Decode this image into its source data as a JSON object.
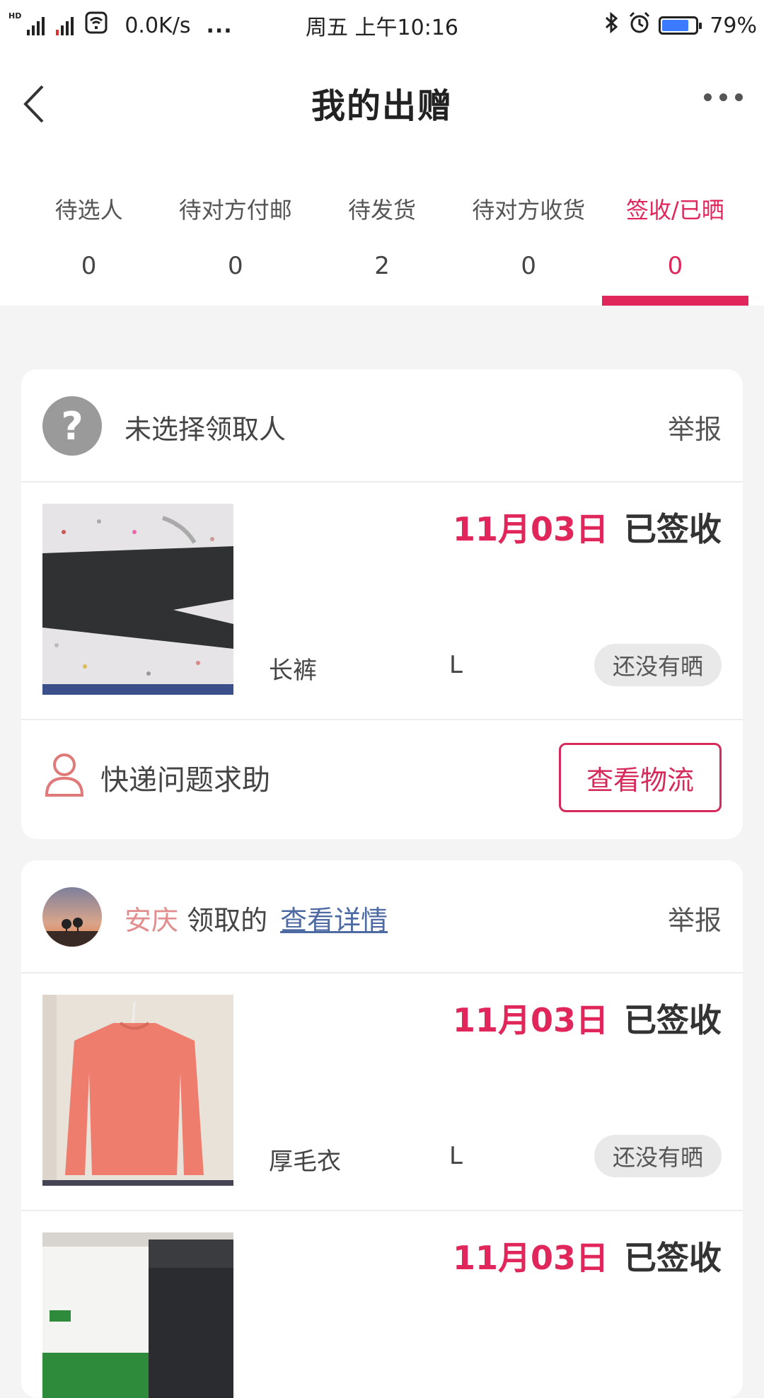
{
  "status_bar": {
    "hd": "HD",
    "speed": "0.0K/s",
    "dots": "...",
    "time": "周五 上午10:16",
    "battery": "79%"
  },
  "header": {
    "title": "我的出赠"
  },
  "tabs": [
    {
      "label": "待选人",
      "count": "0"
    },
    {
      "label": "待对方付邮",
      "count": "0"
    },
    {
      "label": "待发货",
      "count": "2"
    },
    {
      "label": "待对方收货",
      "count": "0"
    },
    {
      "label": "签收/已晒",
      "count": "0"
    }
  ],
  "colors": {
    "accent": "#e0265a",
    "link": "#4d6aa3"
  },
  "card1": {
    "avatar_glyph": "?",
    "head_text": "未选择领取人",
    "report": "举报",
    "item": {
      "date": "11月03日",
      "status": "已签收",
      "name": "长裤",
      "size": "L",
      "pill": "还没有晒"
    },
    "help_text": "快递问题求助",
    "logistics_button": "查看物流"
  },
  "card2": {
    "city": "安庆",
    "claimed": " 领取的",
    "detail_link": "查看详情",
    "report": "举报",
    "items": [
      {
        "date": "11月03日",
        "status": "已签收",
        "name": "厚毛衣",
        "size": "L",
        "pill": "还没有晒"
      },
      {
        "date": "11月03日",
        "status": "已签收"
      }
    ]
  }
}
